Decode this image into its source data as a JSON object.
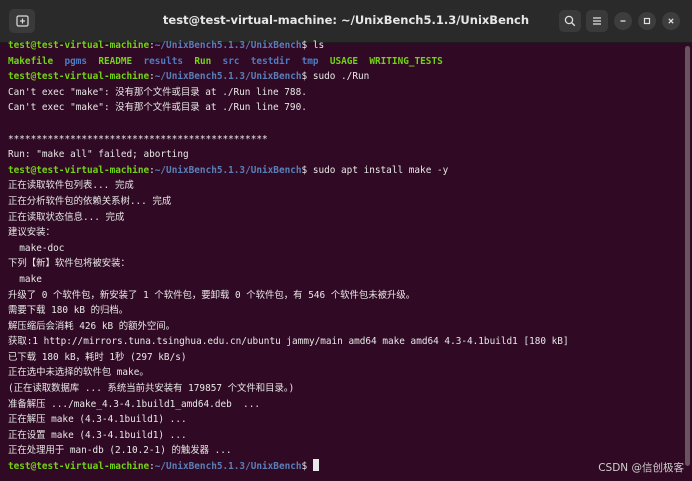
{
  "window": {
    "title": "test@test-virtual-machine: ~/UnixBench5.1.3/UnixBench"
  },
  "titlebar": {
    "new_tab_icon": "terminal-tab-icon",
    "search_icon": "search-icon",
    "menu_icon": "hamburger-menu-icon",
    "minimize_icon": "minimize-icon",
    "maximize_icon": "maximize-icon",
    "close_icon": "close-icon"
  },
  "prompt": {
    "user": "test@test-virtual-machine",
    "sep": ":",
    "path": "~/UnixBench5.1.3/UnixBench",
    "sigil": "$ "
  },
  "colors": {
    "background": "#300a24",
    "user": "#73d216",
    "path": "#5a7fb8"
  },
  "commands": {
    "c1": "ls",
    "c2": "sudo ./Run",
    "c3": "sudo apt install make -y"
  },
  "ls_output": {
    "i1": "Makefile",
    "i2": "pgms",
    "i3": "README",
    "i4": "results",
    "i5": "Run",
    "i6": "src",
    "i7": "testdir",
    "i8": "tmp",
    "i9": "USAGE",
    "i10": "WRITING_TESTS"
  },
  "output": {
    "o1": "Can't exec \"make\": 没有那个文件或目录 at ./Run line 788.",
    "o2": "Can't exec \"make\": 没有那个文件或目录 at ./Run line 790.",
    "o3": "**********************************************",
    "o4": "Run: \"make all\" failed; aborting",
    "o5": "正在读取软件包列表... 完成",
    "o6": "正在分析软件包的依赖关系树... 完成",
    "o7": "正在读取状态信息... 完成",
    "o8": "建议安装：",
    "o9": "  make-doc",
    "o10": "下列【新】软件包将被安装：",
    "o11": "  make",
    "o12": "升级了 0 个软件包，新安装了 1 个软件包，要卸载 0 个软件包，有 546 个软件包未被升级。",
    "o13": "需要下载 180 kB 的归档。",
    "o14": "解压缩后会消耗 426 kB 的额外空间。",
    "o15": "获取:1 http://mirrors.tuna.tsinghua.edu.cn/ubuntu jammy/main amd64 make amd64 4.3-4.1build1 [180 kB]",
    "o16": "已下载 180 kB，耗时 1秒 (297 kB/s)",
    "o17": "正在选中未选择的软件包 make。",
    "o18": "(正在读取数据库 ... 系统当前共安装有 179857 个文件和目录。)",
    "o19": "准备解压 .../make_4.3-4.1build1_amd64.deb  ...",
    "o20": "正在解压 make (4.3-4.1build1) ...",
    "o21": "正在设置 make (4.3-4.1build1) ...",
    "o22": "正在处理用于 man-db (2.10.2-1) 的触发器 ..."
  },
  "watermark": "CSDN @信创极客"
}
